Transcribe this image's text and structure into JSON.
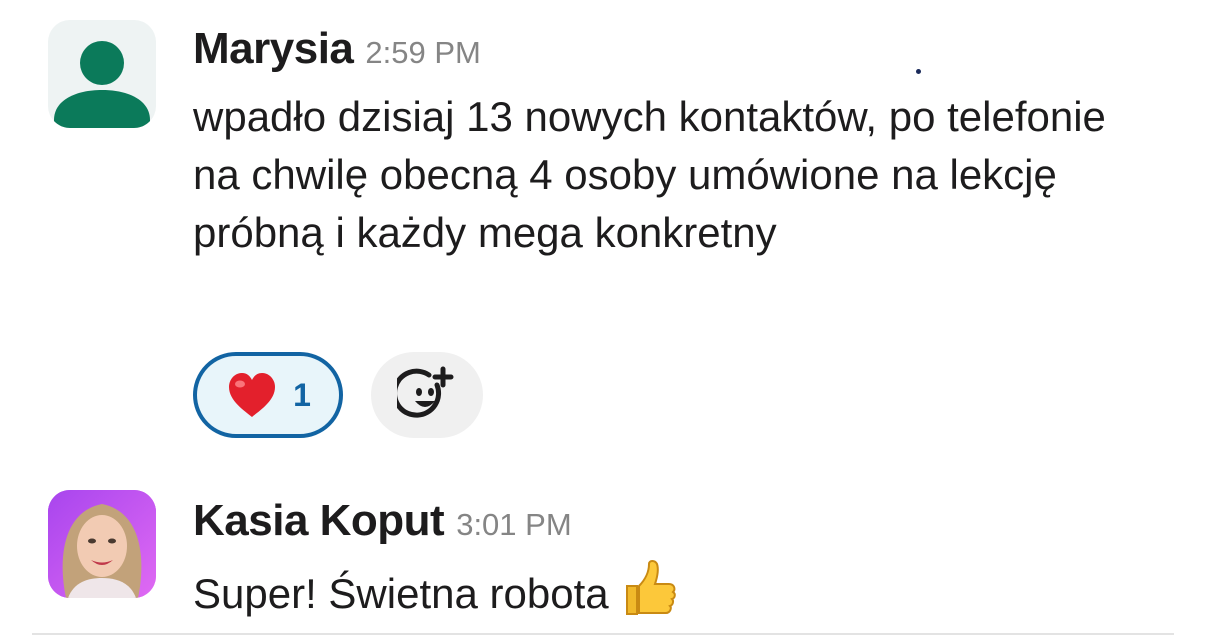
{
  "messages": [
    {
      "author": "Marysia",
      "timestamp": "2:59 PM",
      "text": "wpadło dzisiaj 13 nowych kontaktów, po telefonie na chwilę obecną 4 osoby umówione na lekcję próbną i każdy mega konkretny",
      "avatar": "default-user-avatar",
      "reactions": [
        {
          "emoji": "heart",
          "count": "1",
          "selected": true
        }
      ],
      "add_reaction_icon": "add-reaction-icon"
    },
    {
      "author": "Kasia Koput",
      "timestamp": "3:01 PM",
      "text": "Super! Świetna robota",
      "avatar": "user-photo",
      "trailing_emoji": "thumbs-up"
    }
  ],
  "colors": {
    "accent": "#1264a3",
    "reaction_bg": "#e8f5fa",
    "default_avatar": "#0b7a5a",
    "timestamp": "#858585"
  }
}
